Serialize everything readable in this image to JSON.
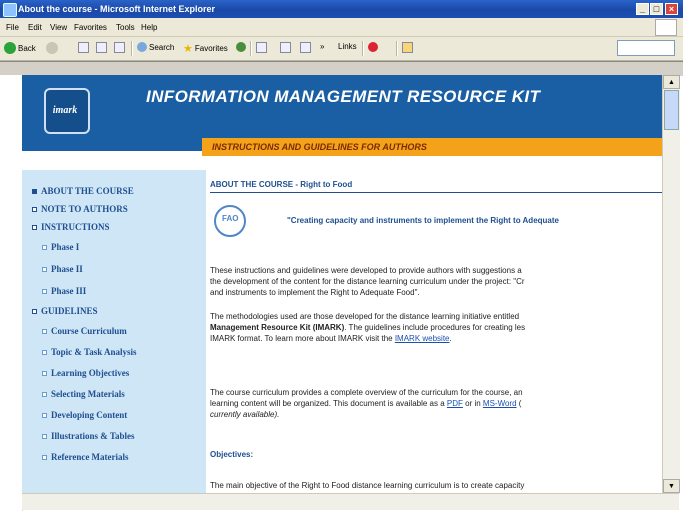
{
  "window": {
    "title": "About the course - Microsoft Internet Explorer"
  },
  "menu": [
    "File",
    "Edit",
    "View",
    "Favorites",
    "Tools",
    "Help"
  ],
  "toolbar": {
    "back": "Back",
    "search": "Search",
    "favorites": "Favorites",
    "links": "Links"
  },
  "site": {
    "title": "INFORMATION MANAGEMENT RESOURCE KIT",
    "logo_text": "imark",
    "subtitle": "INSTRUCTIONS AND GUIDELINES FOR AUTHORS"
  },
  "sidebar": {
    "items": [
      {
        "label": "ABOUT THE COURSE"
      },
      {
        "label": "NOTE TO AUTHORS"
      },
      {
        "label": "INSTRUCTIONS"
      },
      {
        "label": "Phase I"
      },
      {
        "label": "Phase II"
      },
      {
        "label": "Phase III"
      },
      {
        "label": "GUIDELINES"
      },
      {
        "label": "Course Curriculum"
      },
      {
        "label": "Topic & Task Analysis"
      },
      {
        "label": "Learning Objectives"
      },
      {
        "label": "Selecting Materials"
      },
      {
        "label": "Developing Content"
      },
      {
        "label": "Illustrations & Tables"
      },
      {
        "label": "Reference Materials"
      }
    ]
  },
  "content": {
    "section_head": "ABOUT THE COURSE - Right to Food",
    "fao_label": "FAO",
    "quote": "\"Creating capacity and instruments to implement the Right to Adequate",
    "p1_l1": "These instructions and guidelines were developed to provide authors with suggestions a",
    "p1_l2": "the development of the content for the distance learning curriculum under the project: \"Cr",
    "p1_l3": "and instruments to implement the Right to Adequate Food\".",
    "p2_l1": "The methodologies used are those developed for the distance learning initiative entitled",
    "p2_l2_bold": "Management Resource Kit (IMARK)",
    "p2_l2_rest": ". The guidelines include procedures for creating les",
    "p2_l3_pre": "IMARK format. To learn more about IMARK visit the ",
    "p2_l3_link": "IMARK website",
    "p2_l3_post": ".",
    "p3_l1": "The course curriculum provides a complete overview of the curriculum for the course, an",
    "p3_l2_pre": "learning content will be organized. This document is available as a ",
    "p3_l2_link1": "PDF",
    "p3_l2_mid": " or in ",
    "p3_l2_link2": "MS-Word",
    "p3_l2_post": " (",
    "p3_l3": "currently available).",
    "objectives": "Objectives:",
    "p4_l1": "The main objective of the Right to Food distance learning curriculum is to create capacity"
  },
  "colors": {
    "header_blue": "#1a5fa3",
    "orange": "#f5a21b",
    "sidebar_bg": "#cfe6f7",
    "nav_text": "#1f4f8f"
  }
}
